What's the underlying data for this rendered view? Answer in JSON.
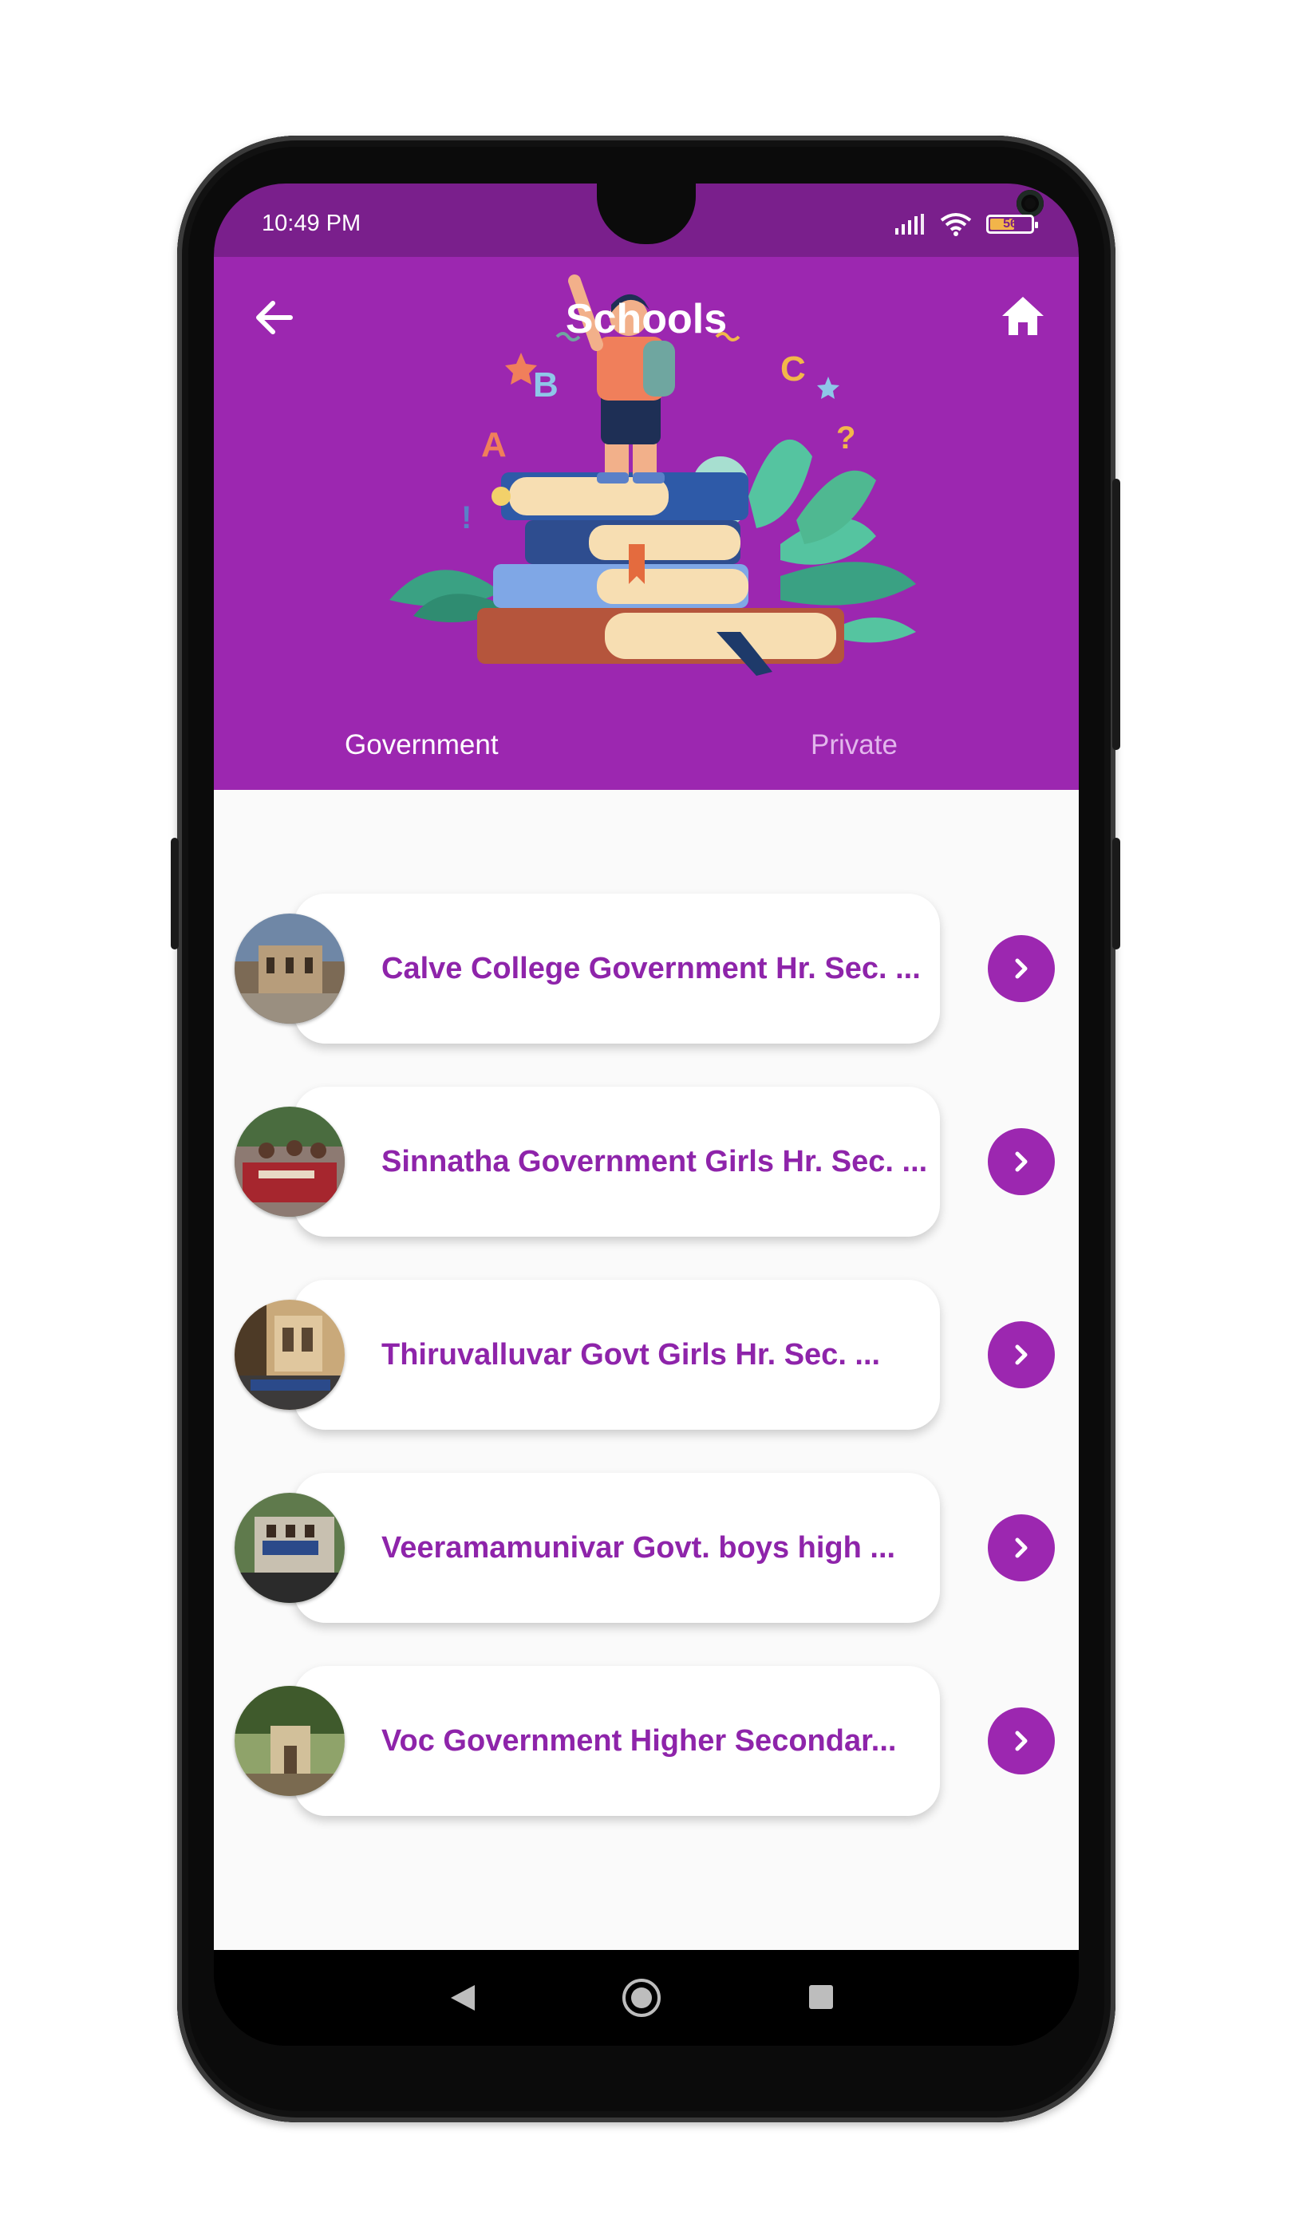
{
  "status_bar": {
    "time": "10:49 PM",
    "battery": "56"
  },
  "header": {
    "title": "Schools",
    "back_icon": "arrow-left-icon",
    "home_icon": "home-icon",
    "bg_color": "#9c27b0"
  },
  "tabs": [
    {
      "label": "Government",
      "active": true
    },
    {
      "label": "Private",
      "active": false
    }
  ],
  "schools": [
    {
      "name": "Calve College Government Hr. Sec. ..."
    },
    {
      "name": "Sinnatha Government Girls Hr. Sec. ..."
    },
    {
      "name": "Thiruvalluvar Govt Girls Hr. Sec. ..."
    },
    {
      "name": "Veeramamunivar Govt. boys high ..."
    },
    {
      "name": "Voc Government Higher Secondar..."
    }
  ],
  "accent_color": "#8e24aa"
}
